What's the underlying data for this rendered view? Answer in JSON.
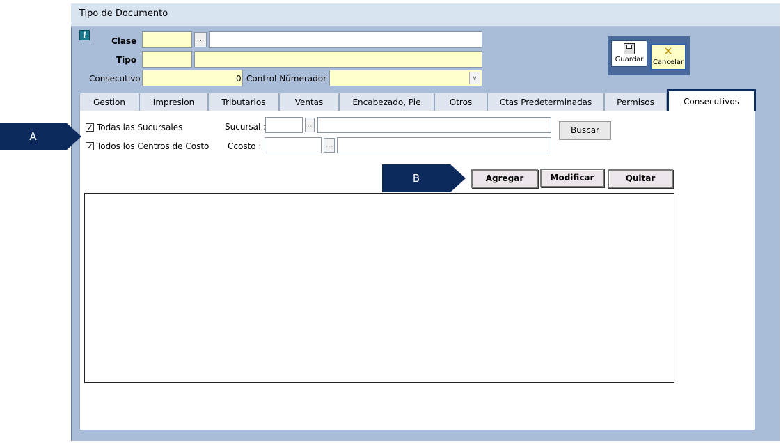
{
  "window": {
    "title": "Tipo de Documento"
  },
  "header": {
    "clase_label": "Clase",
    "tipo_label": "Tipo",
    "consecutivo_label": "Consecutivo",
    "consecutivo_value": "0",
    "control_label": "Control Númerador :",
    "ellipsis": "..."
  },
  "toolbar": {
    "save_label": "Guardar",
    "cancel_label": "Cancelar"
  },
  "tabs": [
    {
      "label": "Gestion"
    },
    {
      "label": "Impresion"
    },
    {
      "label": "Tributarios"
    },
    {
      "label": "Ventas"
    },
    {
      "label": "Encabezado, Pie"
    },
    {
      "label": "Otros"
    },
    {
      "label": "Ctas Predeterminadas"
    },
    {
      "label": "Permisos"
    },
    {
      "label": "Consecutivos"
    }
  ],
  "filters": {
    "todas_sucursales": "Todas las Sucursales",
    "todos_centros": "Todos los Centros de Costo",
    "sucursal_label": "Sucursal :",
    "ccosto_label": "Ccosto :",
    "buscar_prefix": "B",
    "buscar_rest": "uscar",
    "check_mark": "✓",
    "small_ellipsis": ".."
  },
  "actions": {
    "agregar": "Agregar",
    "modificar": "Modificar",
    "quitar": "Quitar"
  },
  "callouts": {
    "a": "A",
    "b": "B"
  }
}
